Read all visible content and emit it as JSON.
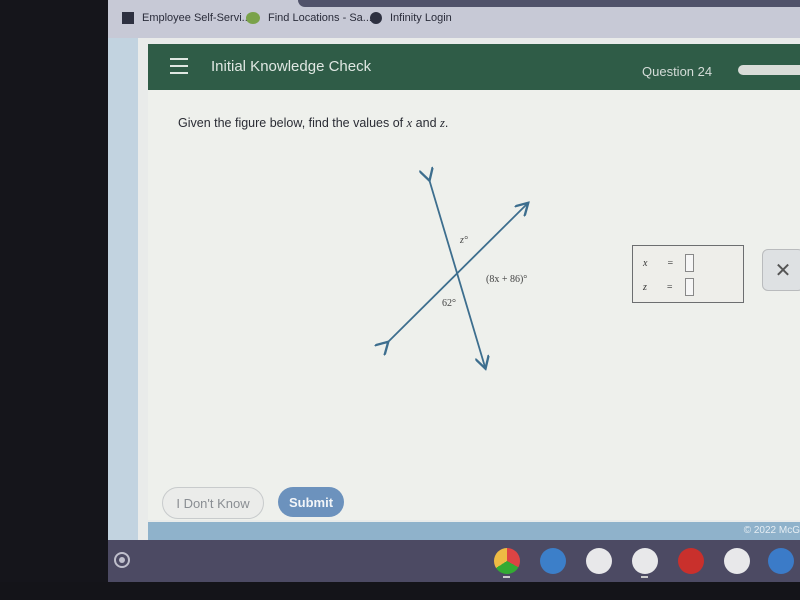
{
  "bookmarks": [
    {
      "label": "Employee Self-Servi...",
      "icon": "square-logo-icon"
    },
    {
      "label": "Find Locations - Sa...",
      "icon": "sd-logo-icon"
    },
    {
      "label": "Infinity Login",
      "icon": "globe-icon"
    }
  ],
  "header": {
    "title": "Initial Knowledge Check",
    "question_label": "Question 24",
    "progress_percent": null
  },
  "question": {
    "prompt_prefix": "Given the figure below, find the values of ",
    "var_x": "x",
    "and": " and ",
    "var_z": "z",
    "period": ".",
    "figure": {
      "label_z": "z°",
      "label_expr": "(8x + 86)°",
      "label_62": "62°"
    }
  },
  "answers": [
    {
      "variable": "x",
      "equals": "=",
      "value": ""
    },
    {
      "variable": "z",
      "equals": "=",
      "value": ""
    }
  ],
  "close_label": "✕",
  "buttons": {
    "dont_know": "I Don't Know",
    "submit": "Submit"
  },
  "footer": {
    "copyright": "© 2022 McG"
  },
  "shelf": {
    "apps": [
      "chrome",
      "files",
      "gmail",
      "docs",
      "youtube",
      "play-store",
      "messages"
    ]
  }
}
